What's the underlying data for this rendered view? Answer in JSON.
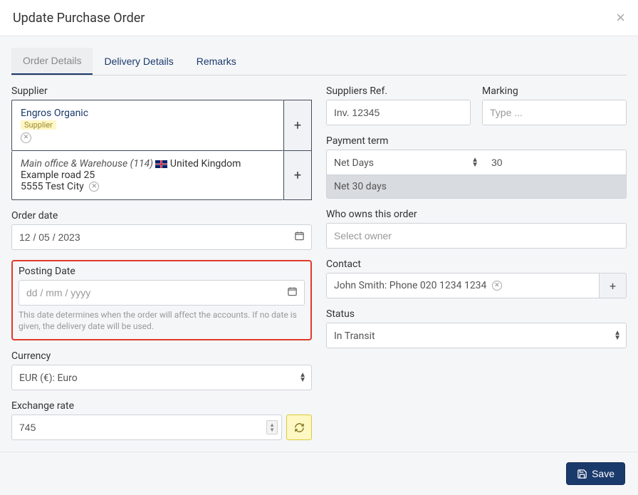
{
  "header": {
    "title": "Update Purchase Order"
  },
  "tabs": {
    "order_details": "Order Details",
    "delivery_details": "Delivery Details",
    "remarks": "Remarks"
  },
  "supplier": {
    "label": "Supplier",
    "name": "Engros Organic",
    "badge": "Supplier",
    "address": {
      "title": "Main office & Warehouse (114)",
      "country": "United Kingdom",
      "line1": "Example road 25",
      "line2": "5555 Test City"
    }
  },
  "suppliers_ref": {
    "label": "Suppliers Ref.",
    "value": "Inv. 12345"
  },
  "marking": {
    "label": "Marking",
    "placeholder": "Type ..."
  },
  "payment_term": {
    "label": "Payment term",
    "type": "Net Days",
    "days": "30",
    "display": "Net 30 days"
  },
  "order_date": {
    "label": "Order date",
    "value": "12 / 05 / 2023"
  },
  "owner": {
    "label": "Who owns this order",
    "placeholder": "Select owner"
  },
  "posting_date": {
    "label": "Posting Date",
    "placeholder": "dd / mm / yyyy",
    "help": "This date determines when the order will affect the accounts. If no date is given, the delivery date will be used."
  },
  "contact": {
    "label": "Contact",
    "value": "John Smith: Phone 020 1234 1234"
  },
  "status": {
    "label": "Status",
    "value": "In Transit"
  },
  "currency": {
    "label": "Currency",
    "value": "EUR (€): Euro"
  },
  "exchange_rate": {
    "label": "Exchange rate",
    "value": "745"
  },
  "footer": {
    "save": "Save"
  }
}
